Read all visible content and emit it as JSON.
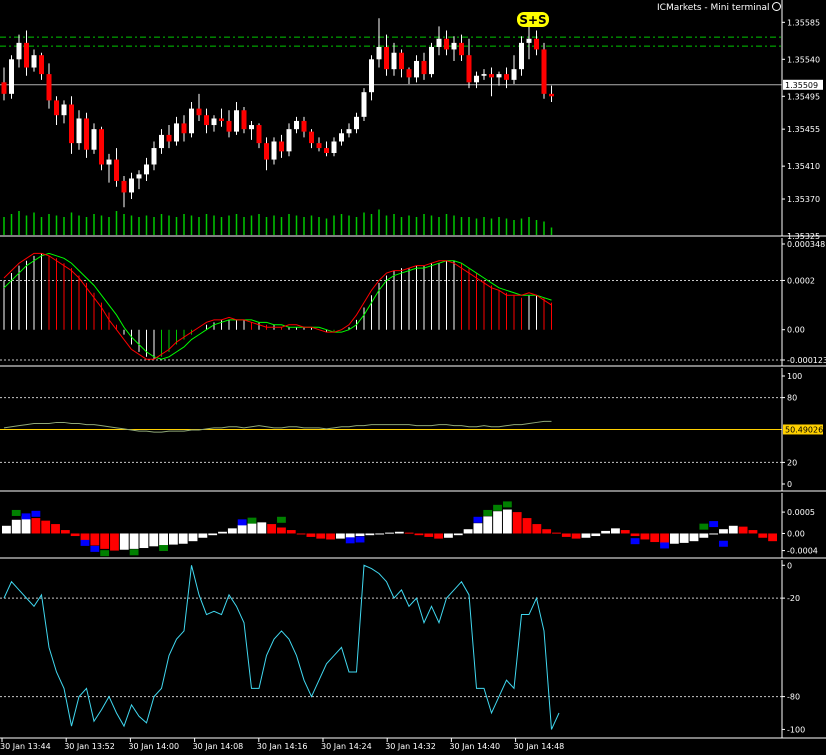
{
  "header": {
    "terminal_title": "ICMarkets - Mini terminal",
    "smiley_icon": "smiley-icon"
  },
  "colors": {
    "background": "#000000",
    "bull_candle": "#ffffff",
    "bear_candle": "#ff0000",
    "volume": "#00c800",
    "level_line": "#00c800",
    "signal_badge": "#ffff00",
    "macd_signal": "#00ff00",
    "macd_main": "#ff0000",
    "rsi_line": "#ffd000",
    "wpr_line": "#40d8f0",
    "osma_up": "#ffffff",
    "osma_down": "#ff0000",
    "osma_blue": "#0000ff",
    "osma_green": "#008000"
  },
  "time_axis": {
    "labels": [
      "30 Jan 13:44",
      "30 Jan 13:52",
      "30 Jan 14:00",
      "30 Jan 14:08",
      "30 Jan 14:16",
      "30 Jan 14:24",
      "30 Jan 14:32",
      "30 Jan 14:40",
      "30 Jan 14:48"
    ]
  },
  "chart_data": [
    {
      "type": "candlestick",
      "panel": "price",
      "price_axis_labels": [
        "1.35585",
        "1.35540",
        "1.35495",
        "1.35455",
        "1.35410",
        "1.35370",
        "1.35325"
      ],
      "ylim": [
        1.35325,
        1.356
      ],
      "current_price": "1.35509",
      "current_price_value": 1.35509,
      "levels": [
        1.35556,
        1.35567
      ],
      "signal_label": "S+S",
      "ohlc": [
        [
          1.35512,
          1.3553,
          1.3549,
          1.35498
        ],
        [
          1.35498,
          1.35545,
          1.35492,
          1.3554
        ],
        [
          1.3554,
          1.3557,
          1.3553,
          1.3556
        ],
        [
          1.3556,
          1.35575,
          1.3552,
          1.3553
        ],
        [
          1.3553,
          1.35552,
          1.35525,
          1.35545
        ],
        [
          1.35545,
          1.35548,
          1.35515,
          1.35522
        ],
        [
          1.35522,
          1.35535,
          1.3548,
          1.3549
        ],
        [
          1.3549,
          1.35495,
          1.3546,
          1.35472
        ],
        [
          1.35472,
          1.3549,
          1.35462,
          1.35485
        ],
        [
          1.35485,
          1.35495,
          1.35425,
          1.35438
        ],
        [
          1.35438,
          1.35478,
          1.3543,
          1.35468
        ],
        [
          1.35468,
          1.35475,
          1.3542,
          1.3543
        ],
        [
          1.3543,
          1.35462,
          1.35425,
          1.35455
        ],
        [
          1.35455,
          1.35458,
          1.35405,
          1.35412
        ],
        [
          1.35412,
          1.35425,
          1.3539,
          1.35418
        ],
        [
          1.35418,
          1.35432,
          1.35385,
          1.35392
        ],
        [
          1.35392,
          1.35398,
          1.3536,
          1.35378
        ],
        [
          1.35378,
          1.35402,
          1.3537,
          1.35395
        ],
        [
          1.35395,
          1.35405,
          1.35382,
          1.354
        ],
        [
          1.354,
          1.3542,
          1.35392,
          1.35412
        ],
        [
          1.35412,
          1.3544,
          1.35405,
          1.35432
        ],
        [
          1.35432,
          1.35455,
          1.35425,
          1.35448
        ],
        [
          1.35448,
          1.3546,
          1.35432,
          1.3544
        ],
        [
          1.3544,
          1.3547,
          1.35435,
          1.35462
        ],
        [
          1.35462,
          1.35472,
          1.3544,
          1.3545
        ],
        [
          1.3545,
          1.35488,
          1.35445,
          1.3548
        ],
        [
          1.3548,
          1.35498,
          1.35465,
          1.35472
        ],
        [
          1.35472,
          1.3548,
          1.3545,
          1.3546
        ],
        [
          1.3546,
          1.35472,
          1.35452,
          1.35468
        ],
        [
          1.35468,
          1.3548,
          1.35458,
          1.35465
        ],
        [
          1.35465,
          1.35478,
          1.35445,
          1.35452
        ],
        [
          1.35452,
          1.35488,
          1.35448,
          1.35478
        ],
        [
          1.35478,
          1.35482,
          1.3545,
          1.35455
        ],
        [
          1.35455,
          1.35465,
          1.35442,
          1.3546
        ],
        [
          1.3546,
          1.35462,
          1.35432,
          1.35438
        ],
        [
          1.35438,
          1.35445,
          1.35405,
          1.35418
        ],
        [
          1.35418,
          1.35445,
          1.35412,
          1.3544
        ],
        [
          1.3544,
          1.35448,
          1.3542,
          1.35428
        ],
        [
          1.35428,
          1.35462,
          1.35422,
          1.35455
        ],
        [
          1.35455,
          1.3547,
          1.3545,
          1.35465
        ],
        [
          1.35465,
          1.3547,
          1.35445,
          1.35452
        ],
        [
          1.35452,
          1.35455,
          1.35432,
          1.35438
        ],
        [
          1.35438,
          1.35445,
          1.35428,
          1.35432
        ],
        [
          1.35432,
          1.3544,
          1.35422,
          1.35426
        ],
        [
          1.35426,
          1.35445,
          1.35422,
          1.3544
        ],
        [
          1.3544,
          1.35455,
          1.35435,
          1.3545
        ],
        [
          1.3545,
          1.35462,
          1.35445,
          1.35455
        ],
        [
          1.35455,
          1.35475,
          1.3545,
          1.3547
        ],
        [
          1.3547,
          1.35505,
          1.35465,
          1.355
        ],
        [
          1.355,
          1.35545,
          1.3549,
          1.3554
        ],
        [
          1.3554,
          1.3559,
          1.3553,
          1.35555
        ],
        [
          1.35555,
          1.3557,
          1.3552,
          1.35528
        ],
        [
          1.35528,
          1.3556,
          1.3552,
          1.35548
        ],
        [
          1.35548,
          1.35552,
          1.35518,
          1.35528
        ],
        [
          1.35528,
          1.3553,
          1.3551,
          1.35518
        ],
        [
          1.35518,
          1.35545,
          1.35512,
          1.35538
        ],
        [
          1.35538,
          1.35548,
          1.35515,
          1.35522
        ],
        [
          1.35522,
          1.3556,
          1.35518,
          1.35555
        ],
        [
          1.35555,
          1.3558,
          1.35545,
          1.35565
        ],
        [
          1.35565,
          1.35575,
          1.35545,
          1.35552
        ],
        [
          1.35552,
          1.35568,
          1.35538,
          1.3556
        ],
        [
          1.3556,
          1.3557,
          1.35538,
          1.35545
        ],
        [
          1.35545,
          1.35565,
          1.35505,
          1.35512
        ],
        [
          1.35512,
          1.35525,
          1.35505,
          1.3552
        ],
        [
          1.3552,
          1.35528,
          1.35515,
          1.35522
        ],
        [
          1.35522,
          1.3553,
          1.35495,
          1.35518
        ],
        [
          1.35518,
          1.35525,
          1.35508,
          1.35522
        ],
        [
          1.35522,
          1.3553,
          1.35505,
          1.35515
        ],
        [
          1.35515,
          1.35545,
          1.3551,
          1.35528
        ],
        [
          1.35528,
          1.35568,
          1.3552,
          1.3556
        ],
        [
          1.3556,
          1.3558,
          1.3554,
          1.35565
        ],
        [
          1.35565,
          1.35575,
          1.35545,
          1.35552
        ],
        [
          1.35552,
          1.3556,
          1.35492,
          1.35498
        ],
        [
          1.35498,
          1.35508,
          1.35488,
          1.35495
        ]
      ]
    },
    {
      "type": "bar",
      "panel": "volume",
      "values": [
        12,
        14,
        16,
        13,
        15,
        12,
        14,
        13,
        12,
        15,
        13,
        12,
        14,
        13,
        12,
        16,
        14,
        13,
        12,
        13,
        12,
        14,
        13,
        12,
        14,
        13,
        12,
        14,
        13,
        12,
        13,
        14,
        12,
        13,
        14,
        12,
        13,
        12,
        14,
        13,
        12,
        13,
        12,
        11,
        13,
        14,
        13,
        12,
        15,
        14,
        17,
        13,
        14,
        12,
        13,
        12,
        14,
        13,
        12,
        14,
        13,
        12,
        12,
        11,
        12,
        11,
        12,
        11,
        10,
        11,
        12,
        10,
        9,
        5
      ],
      "ylim": [
        0,
        20
      ]
    },
    {
      "type": "line",
      "panel": "macd",
      "axis_labels": [
        "0.000348",
        "0.0002",
        "0.00",
        "-0.000123"
      ],
      "ylim": [
        -0.000123,
        0.000348
      ],
      "dashed_levels": [
        0.0002,
        -0.000123
      ],
      "histogram": [
        0.0002,
        0.00023,
        0.00026,
        0.00028,
        0.0003,
        0.00031,
        0.0003,
        0.00029,
        0.00027,
        0.00025,
        0.00022,
        0.00019,
        0.00015,
        0.00011,
        7e-05,
        2e-05,
        -2e-05,
        -6e-05,
        -9e-05,
        -0.00011,
        -0.00012,
        -0.00011,
        -9e-05,
        -6e-05,
        -4e-05,
        -2e-05,
        0.0,
        2e-05,
        3e-05,
        4e-05,
        4e-05,
        4e-05,
        4e-05,
        3e-05,
        3e-05,
        2e-05,
        2e-05,
        1e-05,
        1e-05,
        1e-05,
        1e-05,
        1e-05,
        0.0,
        -1e-05,
        -1e-05,
        0.0,
        1e-05,
        4e-05,
        9e-05,
        0.00014,
        0.00019,
        0.00022,
        0.00024,
        0.00025,
        0.00025,
        0.00026,
        0.00026,
        0.00027,
        0.00027,
        0.00028,
        0.00028,
        0.00027,
        0.00025,
        0.00023,
        0.0002,
        0.00018,
        0.00016,
        0.00015,
        0.00014,
        0.00013,
        0.00014,
        0.00014,
        0.00013,
        0.00011
      ],
      "main": [
        0.00021,
        0.00024,
        0.00027,
        0.00029,
        0.00031,
        0.00031,
        0.0003,
        0.00028,
        0.00026,
        0.00024,
        0.00021,
        0.00017,
        0.00013,
        9e-05,
        4e-05,
        0.0,
        -4e-05,
        -8e-05,
        -0.0001,
        -0.00012,
        -0.00012,
        -0.0001,
        -8e-05,
        -5e-05,
        -3e-05,
        -1e-05,
        1e-05,
        3e-05,
        4e-05,
        4e-05,
        5e-05,
        4e-05,
        4e-05,
        3e-05,
        2e-05,
        1e-05,
        1e-05,
        1e-05,
        2e-05,
        2e-05,
        1e-05,
        1e-05,
        0.0,
        -1e-05,
        -1e-05,
        0.0,
        2e-05,
        6e-05,
        0.00011,
        0.00016,
        0.0002,
        0.00023,
        0.00024,
        0.00024,
        0.00025,
        0.00026,
        0.00026,
        0.00027,
        0.00028,
        0.00028,
        0.00027,
        0.00025,
        0.00023,
        0.00021,
        0.00019,
        0.00017,
        0.00016,
        0.00014,
        0.00014,
        0.00014,
        0.00015,
        0.00014,
        0.00012,
        0.0001
      ],
      "signal": [
        0.00017,
        0.0002,
        0.00023,
        0.00026,
        0.00028,
        0.0003,
        0.00031,
        0.0003,
        0.00029,
        0.00027,
        0.00024,
        0.00021,
        0.00018,
        0.00014,
        0.0001,
        6e-05,
        1e-05,
        -3e-05,
        -6e-05,
        -9e-05,
        -0.00011,
        -0.00012,
        -0.00011,
        -9e-05,
        -7e-05,
        -4e-05,
        -2e-05,
        0.0,
        2e-05,
        3e-05,
        4e-05,
        4e-05,
        4e-05,
        4e-05,
        3e-05,
        3e-05,
        2e-05,
        2e-05,
        1e-05,
        1e-05,
        1e-05,
        1e-05,
        1e-05,
        0.0,
        -1e-05,
        -1e-05,
        0.0,
        2e-05,
        6e-05,
        0.00011,
        0.00016,
        0.0002,
        0.00022,
        0.00023,
        0.00024,
        0.00025,
        0.00025,
        0.00026,
        0.00027,
        0.00028,
        0.00028,
        0.00027,
        0.00025,
        0.00023,
        0.00021,
        0.00019,
        0.00017,
        0.00016,
        0.00015,
        0.00014,
        0.00014,
        0.00014,
        0.00013,
        0.00012
      ]
    },
    {
      "type": "line",
      "panel": "rsi",
      "axis_labels": [
        "100",
        "80",
        "20",
        "0"
      ],
      "ylim": [
        0,
        100
      ],
      "dashed_levels": [
        80,
        20
      ],
      "current_value": "50.49026",
      "current_value_num": 50.49,
      "line_level": 50.49,
      "values": [
        52,
        53,
        54,
        55,
        56,
        56,
        56,
        57,
        57,
        56,
        56,
        55,
        55,
        54,
        53,
        52,
        51,
        50,
        49,
        49,
        48,
        48,
        49,
        49,
        49,
        50,
        50,
        51,
        52,
        52,
        53,
        53,
        52,
        53,
        54,
        53,
        52,
        52,
        53,
        53,
        52,
        52,
        52,
        51,
        52,
        53,
        53,
        54,
        54,
        55,
        55,
        55,
        55,
        55,
        55,
        54,
        54,
        54,
        55,
        55,
        54,
        54,
        53,
        53,
        54,
        53,
        53,
        54,
        55,
        55,
        56,
        57,
        58,
        58
      ]
    },
    {
      "type": "bar",
      "panel": "osma",
      "axis_labels": [
        "0.0005",
        "0.00",
        "-0.0004"
      ],
      "ylim": [
        -0.00055,
        0.0009
      ],
      "values": [
        0.00018,
        0.00032,
        0.0004,
        0.00036,
        0.0003,
        0.00022,
        8e-05,
        -6e-05,
        -0.00018,
        -0.00028,
        -0.00036,
        -0.0004,
        -0.00038,
        -0.00036,
        -0.00034,
        -0.0003,
        -0.00028,
        -0.00026,
        -0.00024,
        -0.00018,
        -0.0001,
        -4e-05,
        4e-05,
        0.00012,
        0.0002,
        0.00024,
        0.00026,
        0.00022,
        0.00014,
        8e-05,
        -2e-05,
        -8e-05,
        -0.00012,
        -0.00014,
        -0.00012,
        -0.0001,
        -6e-05,
        -4e-05,
        -2e-05,
        2e-05,
        4e-05,
        2e-05,
        -4e-05,
        -8e-05,
        -0.00012,
        -0.0001,
        -4e-05,
        0.0001,
        0.00024,
        0.0004,
        0.00052,
        0.00056,
        0.0005,
        0.00036,
        0.00022,
        0.0001,
        2e-05,
        -8e-05,
        -0.00012,
        -0.0001,
        -6e-05,
        6e-05,
        0.00012,
        8e-05,
        -6e-05,
        -0.00014,
        -0.0002,
        -0.00024,
        -0.00024,
        -0.00022,
        -0.00018,
        -0.0001,
        -2e-05,
        0.0001,
        0.00018,
        0.00016,
        8e-05,
        -0.0001,
        -0.00018
      ],
      "markers": [
        {
          "index": 1,
          "value": 0.00048,
          "color": "green"
        },
        {
          "index": 2,
          "value": 0.0004,
          "color": "blue"
        },
        {
          "index": 3,
          "value": 0.00046,
          "color": "blue"
        },
        {
          "index": 8,
          "value": -0.00022,
          "color": "blue"
        },
        {
          "index": 9,
          "value": -0.00036,
          "color": "blue"
        },
        {
          "index": 10,
          "value": -0.00046,
          "color": "green"
        },
        {
          "index": 13,
          "value": -0.00044,
          "color": "green"
        },
        {
          "index": 16,
          "value": -0.00034,
          "color": "green"
        },
        {
          "index": 24,
          "value": 0.00026,
          "color": "blue"
        },
        {
          "index": 25,
          "value": 0.0003,
          "color": "green"
        },
        {
          "index": 28,
          "value": 0.00032,
          "color": "green"
        },
        {
          "index": 35,
          "value": -0.00016,
          "color": "blue"
        },
        {
          "index": 36,
          "value": -0.00014,
          "color": "blue"
        },
        {
          "index": 48,
          "value": 0.00032,
          "color": "blue"
        },
        {
          "index": 49,
          "value": 0.00048,
          "color": "green"
        },
        {
          "index": 50,
          "value": 0.0006,
          "color": "green"
        },
        {
          "index": 51,
          "value": 0.00068,
          "color": "green"
        },
        {
          "index": 64,
          "value": -0.00018,
          "color": "blue"
        },
        {
          "index": 67,
          "value": -0.00028,
          "color": "blue"
        },
        {
          "index": 71,
          "value": 0.00016,
          "color": "green"
        },
        {
          "index": 72,
          "value": 0.00022,
          "color": "blue"
        },
        {
          "index": 73,
          "value": -0.00024,
          "color": "blue"
        }
      ]
    },
    {
      "type": "line",
      "panel": "wpr",
      "axis_labels": [
        "0",
        "-20",
        "-80",
        "-100"
      ],
      "ylim": [
        -104,
        2
      ],
      "dashed_levels": [
        -20,
        -80
      ],
      "values": [
        -20,
        -10,
        -15,
        -20,
        -25,
        -18,
        -50,
        -65,
        -75,
        -98,
        -80,
        -75,
        -95,
        -88,
        -80,
        -90,
        -98,
        -85,
        -92,
        -96,
        -80,
        -75,
        -55,
        -45,
        -40,
        0,
        -18,
        -30,
        -28,
        -30,
        -18,
        -25,
        -35,
        -75,
        -75,
        -55,
        -45,
        -40,
        -45,
        -55,
        -70,
        -80,
        -70,
        -60,
        -55,
        -50,
        -65,
        -65,
        0,
        -2,
        -5,
        -10,
        -20,
        -15,
        -25,
        -20,
        -35,
        -25,
        -35,
        -20,
        -15,
        -10,
        -18,
        -75,
        -75,
        -90,
        -80,
        -70,
        -75,
        -30,
        -30,
        -20,
        -40,
        -100,
        -90
      ]
    }
  ]
}
